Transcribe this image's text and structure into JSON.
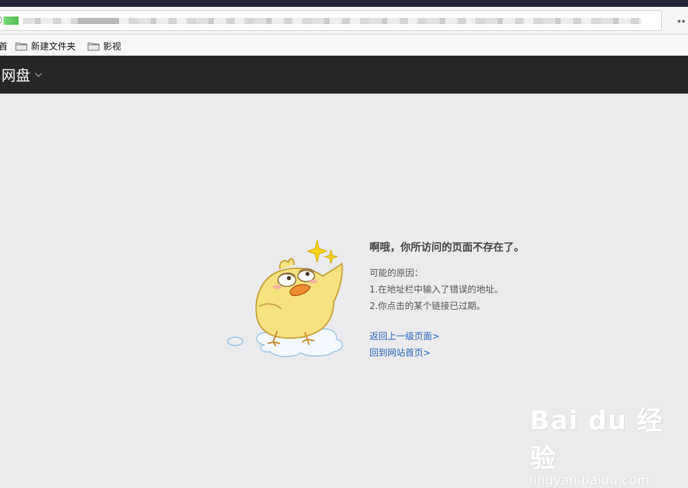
{
  "browser": {
    "bookmarks": [
      {
        "label": "首",
        "icon": "none"
      },
      {
        "label": "新建文件夹",
        "icon": "folder-icon"
      },
      {
        "label": "影视",
        "icon": "folder-icon"
      }
    ]
  },
  "app": {
    "brand": "网盘"
  },
  "error": {
    "title": "啊哦，你所访问的页面不存在了。",
    "reasons_heading": "可能的原因：",
    "reasons": [
      "1.在地址栏中输入了错误的地址。",
      "2.你点击的某个链接已过期。"
    ],
    "links": [
      "返回上一级页面>",
      "回到网站首页>"
    ]
  },
  "watermark": {
    "logo": "Bai du 经验",
    "sub": "jingyan.baidu.com"
  },
  "colors": {
    "appbar": "#262626",
    "link": "#2363b8",
    "background": "#ebebed"
  }
}
